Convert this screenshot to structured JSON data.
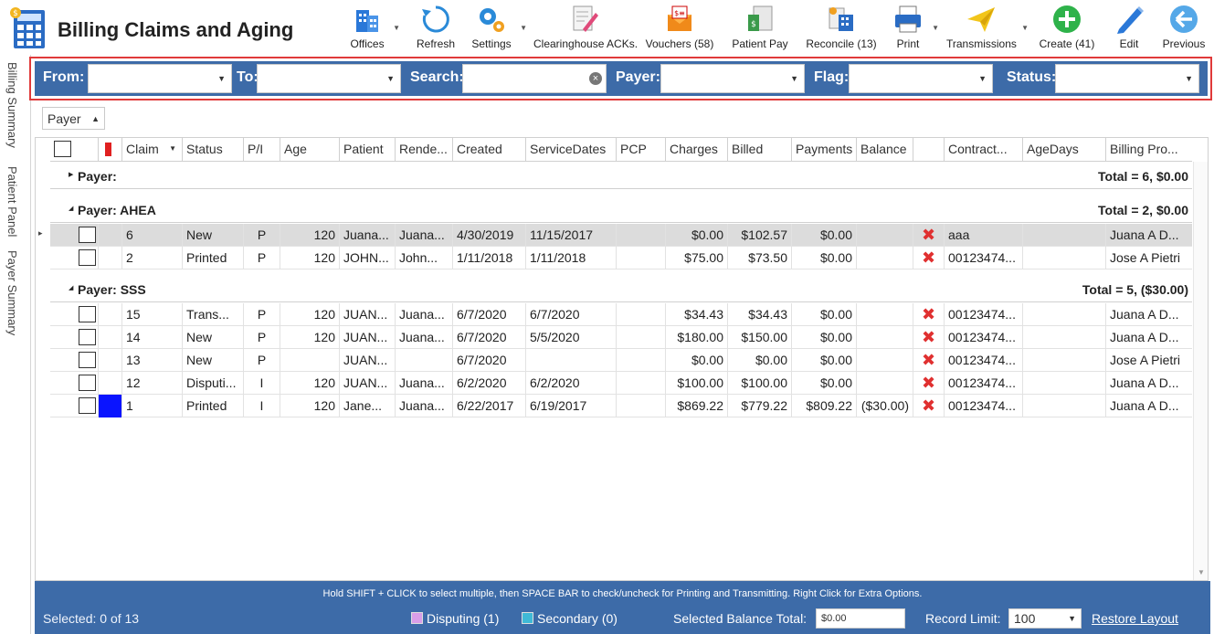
{
  "app": {
    "title": "Billing Claims and Aging"
  },
  "toolbar": [
    {
      "label": "Offices",
      "icon": "offices-icon"
    },
    {
      "label": "Refresh",
      "icon": "refresh-icon"
    },
    {
      "label": "Settings",
      "icon": "settings-icon"
    },
    {
      "label": "Clearinghouse ACKs.",
      "icon": "clearinghouse-icon"
    },
    {
      "label": "Vouchers (58)",
      "icon": "vouchers-icon"
    },
    {
      "label": "Patient Pay",
      "icon": "patient-pay-icon"
    },
    {
      "label": "Reconcile (13)",
      "icon": "reconcile-icon"
    },
    {
      "label": "Print",
      "icon": "print-icon"
    },
    {
      "label": "Transmissions",
      "icon": "transmissions-icon"
    },
    {
      "label": "Create (41)",
      "icon": "create-icon"
    },
    {
      "label": "Edit",
      "icon": "edit-icon"
    },
    {
      "label": "Previous",
      "icon": "previous-icon"
    }
  ],
  "sidebar": {
    "tabs": [
      "Billing Summary",
      "Patient Panel",
      "Payer Summary"
    ]
  },
  "filters": {
    "from_label": "From:",
    "to_label": "To:",
    "search_label": "Search:",
    "payer_label": "Payer:",
    "flag_label": "Flag:",
    "status_label": "Status:",
    "from_value": "",
    "to_value": "",
    "search_value": "",
    "payer_value": "",
    "flag_value": "",
    "status_value": ""
  },
  "grouping": {
    "label": "Payer"
  },
  "columns": [
    "Claim",
    "Status",
    "P/I",
    "Age",
    "Patient",
    "Rende...",
    "Created",
    "ServiceDates",
    "PCP",
    "Charges",
    "Billed",
    "Payments",
    "Balance",
    "",
    "Contract...",
    "AgeDays",
    "Billing Pro..."
  ],
  "groups": [
    {
      "name": "Payer:",
      "total": "Total = 6,  $0.00",
      "expanded": false,
      "rows": []
    },
    {
      "name": "Payer: AHEA",
      "total": "Total = 2,  $0.00",
      "expanded": true,
      "rows": [
        {
          "claim": "6",
          "status": "New",
          "pi": "P",
          "age": "120",
          "patient": "Juana...",
          "rend": "Juana...",
          "created": "4/30/2019",
          "service": "11/15/2017",
          "pcp": "",
          "charges": "$0.00",
          "billed": "$102.57",
          "payments": "$0.00",
          "balance": "",
          "contract": "aaa",
          "agedays": "",
          "billpro": "Juana A D...",
          "selected": true,
          "flag": ""
        },
        {
          "claim": "2",
          "status": "Printed",
          "pi": "P",
          "age": "120",
          "patient": "JOHN...",
          "rend": "John...",
          "created": "1/11/2018",
          "service": "1/11/2018",
          "pcp": "",
          "charges": "$75.00",
          "billed": "$73.50",
          "payments": "$0.00",
          "balance": "",
          "contract": "00123474...",
          "agedays": "",
          "billpro": "Jose A Pietri",
          "selected": false,
          "flag": ""
        }
      ]
    },
    {
      "name": "Payer: SSS",
      "total": "Total = 5,  ($30.00)",
      "expanded": true,
      "rows": [
        {
          "claim": "15",
          "status": "Trans...",
          "pi": "P",
          "age": "120",
          "patient": "JUAN...",
          "rend": "Juana...",
          "created": "6/7/2020",
          "service": "6/7/2020",
          "pcp": "",
          "charges": "$34.43",
          "billed": "$34.43",
          "payments": "$0.00",
          "balance": "",
          "contract": "00123474...",
          "agedays": "",
          "billpro": "Juana A D...",
          "selected": false,
          "flag": ""
        },
        {
          "claim": "14",
          "status": "New",
          "pi": "P",
          "age": "120",
          "patient": "JUAN...",
          "rend": "Juana...",
          "created": "6/7/2020",
          "service": "5/5/2020",
          "pcp": "",
          "charges": "$180.00",
          "billed": "$150.00",
          "payments": "$0.00",
          "balance": "",
          "contract": "00123474...",
          "agedays": "",
          "billpro": "Juana A D...",
          "selected": false,
          "flag": ""
        },
        {
          "claim": "13",
          "status": "New",
          "pi": "P",
          "age": "",
          "patient": "JUAN...",
          "rend": "",
          "created": "6/7/2020",
          "service": "",
          "pcp": "",
          "charges": "$0.00",
          "billed": "$0.00",
          "payments": "$0.00",
          "balance": "",
          "contract": "00123474...",
          "agedays": "",
          "billpro": "Jose A Pietri",
          "selected": false,
          "flag": ""
        },
        {
          "claim": "12",
          "status": "Disputi...",
          "pi": "I",
          "age": "120",
          "patient": "JUAN...",
          "rend": "Juana...",
          "created": "6/2/2020",
          "service": "6/2/2020",
          "pcp": "",
          "charges": "$100.00",
          "billed": "$100.00",
          "payments": "$0.00",
          "balance": "",
          "contract": "00123474...",
          "agedays": "",
          "billpro": "Juana A D...",
          "selected": false,
          "flag": ""
        },
        {
          "claim": "1",
          "status": "Printed",
          "pi": "I",
          "age": "120",
          "patient": "Jane...",
          "rend": "Juana...",
          "created": "6/22/2017",
          "service": "6/19/2017",
          "pcp": "",
          "charges": "$869.22",
          "billed": "$779.22",
          "payments": "$809.22",
          "balance": "($30.00)",
          "contract": "00123474...",
          "agedays": "",
          "billpro": "Juana A D...",
          "selected": false,
          "flag": "#0a14ff"
        }
      ]
    }
  ],
  "colors": {
    "accent": "#3d6ba8",
    "highlight": "#e03a3a",
    "flag_header": "#e02020",
    "disputing": "#d99ee8",
    "secondary": "#3fb9d6"
  },
  "footer": {
    "hint": "Hold SHIFT + CLICK to select multiple, then SPACE BAR to check/uncheck for Printing and Transmitting. Right Click for Extra Options.",
    "selected": "Selected: 0 of 13",
    "disputing": "Disputing (1)",
    "secondary": "Secondary (0)",
    "balance_label": "Selected Balance Total:",
    "balance_value": "$0.00",
    "record_limit_label": "Record Limit:",
    "record_limit_value": "100",
    "restore": "Restore Layout"
  }
}
